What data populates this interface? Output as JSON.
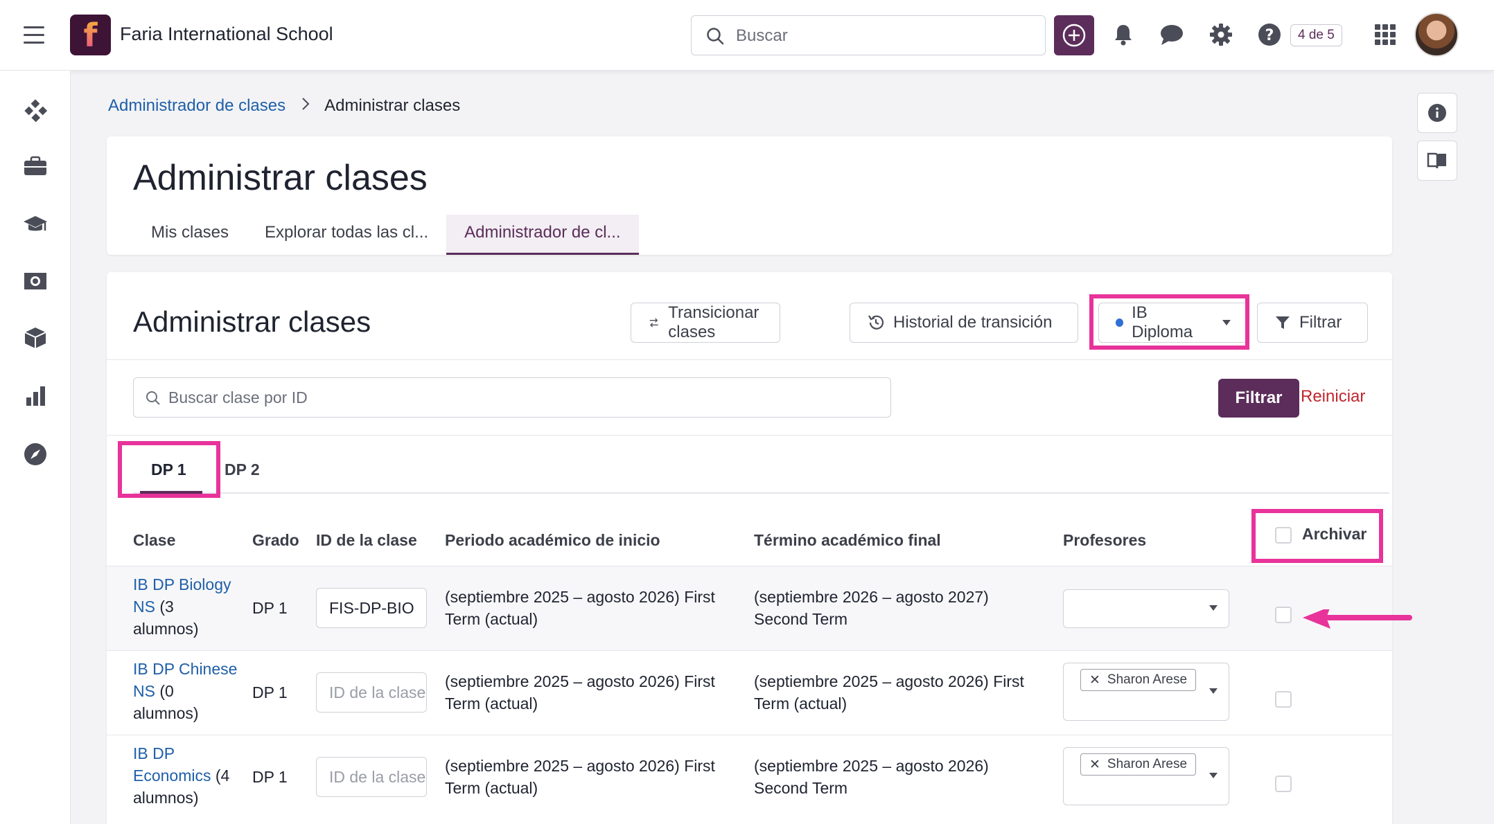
{
  "app": {
    "school_name": "Faria International School"
  },
  "topbar": {
    "search_placeholder": "Buscar",
    "progress_badge": "4 de 5"
  },
  "breadcrumb": {
    "parent": "Administrador de clases",
    "current": "Administrar clases"
  },
  "page": {
    "title": "Administrar clases",
    "tabs": [
      {
        "label": "Mis clases",
        "active": false
      },
      {
        "label": "Explorar todas las cl...",
        "active": false
      },
      {
        "label": "Administrador de cl...",
        "active": true
      }
    ]
  },
  "manage": {
    "title": "Administrar clases",
    "transition_button": "Transicionar clases",
    "history_button": "Historial de transición",
    "program_select": "IB Diploma",
    "filter_button": "Filtrar",
    "search_placeholder": "Buscar clase por ID",
    "filter_submit": "Filtrar",
    "reset": "Reiniciar",
    "grade_tabs": [
      {
        "label": "DP 1",
        "active": true
      },
      {
        "label": "DP 2",
        "active": false
      }
    ]
  },
  "table": {
    "headers": {
      "class": "Clase",
      "grade": "Grado",
      "class_id": "ID de la clase",
      "start_period": "Periodo académico de inicio",
      "end_term": "Término académico final",
      "teachers": "Profesores",
      "archive": "Archivar"
    },
    "id_placeholder": "ID de la clase",
    "rows": [
      {
        "name_line1": "IB DP Biology",
        "name_line2": "NS",
        "count_part": " (3",
        "count_line2": "alumnos)",
        "grade": "DP 1",
        "class_id": "FIS-DP-BIO",
        "start_line1": "(septiembre 2025 – agosto 2026) First",
        "start_line2": "Term (actual)",
        "end_line1": "(septiembre 2026 – agosto 2027)",
        "end_line2": "Second Term",
        "teacher": ""
      },
      {
        "name_line1": "IB DP Chinese",
        "name_line2": "NS",
        "count_part": " (0",
        "count_line2": "alumnos)",
        "grade": "DP 1",
        "class_id": "",
        "start_line1": "(septiembre 2025 – agosto 2026) First",
        "start_line2": "Term (actual)",
        "end_line1": "(septiembre 2025 – agosto 2026) First",
        "end_line2": "Term (actual)",
        "teacher": "Sharon Arese"
      },
      {
        "name_line1": "IB DP",
        "name_line2": "Economics",
        "count_part": " (4",
        "count_line2": "alumnos)",
        "grade": "DP 1",
        "class_id": "",
        "start_line1": "(septiembre 2025 – agosto 2026) First",
        "start_line2": "Term (actual)",
        "end_line1": "(septiembre 2025 – agosto 2026)",
        "end_line2": "Second Term",
        "teacher": "Sharon Arese"
      }
    ]
  },
  "colors": {
    "brand": "#5c2d5a",
    "highlight": "#e8339a",
    "link": "#1e5fa8",
    "reset": "#c0272d"
  }
}
